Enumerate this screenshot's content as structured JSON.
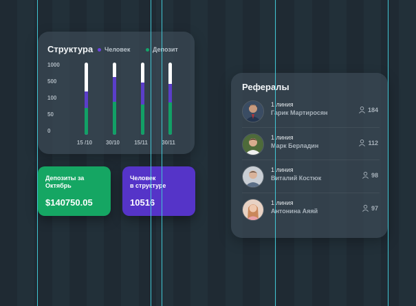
{
  "structure": {
    "title": "Структура",
    "legend": [
      {
        "label": "Человек",
        "color": "#6b44e0"
      },
      {
        "label": "Депозит",
        "color": "#14a56a"
      }
    ],
    "y_ticks": [
      "1000",
      "500",
      "100",
      "50",
      "0"
    ],
    "x_ticks": [
      "15 /10",
      "30/10",
      "15/11",
      "30/11"
    ]
  },
  "chart_data": {
    "type": "bar",
    "title": "Структура",
    "categories": [
      "15 /10",
      "30/10",
      "15/11",
      "30/11"
    ],
    "y_ticks": [
      "1000",
      "500",
      "100",
      "50",
      "0"
    ],
    "series": [
      {
        "name": "Человек",
        "values": [
          0.6,
          0.8,
          0.72,
          0.7
        ]
      },
      {
        "name": "Депозит",
        "values": [
          0.37,
          0.46,
          0.42,
          0.45
        ]
      }
    ]
  },
  "tiles": {
    "deposits": {
      "label": "Депозиты за Октябрь",
      "value": "$140750.05"
    },
    "people": {
      "label_line1": "Человек",
      "label_line2": "в структуре",
      "value": "10516"
    }
  },
  "referrals": {
    "title": "Рефералы",
    "items": [
      {
        "line": "1 линия",
        "name": "Гарик Мартиросян",
        "count": "184",
        "avatar": "avatar-1"
      },
      {
        "line": "1 линия",
        "name": "Марк Берладин",
        "count": "112",
        "avatar": "avatar-2"
      },
      {
        "line": "1 линия",
        "name": "Виталий Костюк",
        "count": "98",
        "avatar": "avatar-3"
      },
      {
        "line": "1 линия",
        "name": "Антонина Аяяй",
        "count": "97",
        "avatar": "avatar-4"
      }
    ]
  },
  "colors": {
    "background": "#1f2a33",
    "guide": "#41c8d6",
    "green": "#15a663",
    "purple": "#5534c8"
  }
}
